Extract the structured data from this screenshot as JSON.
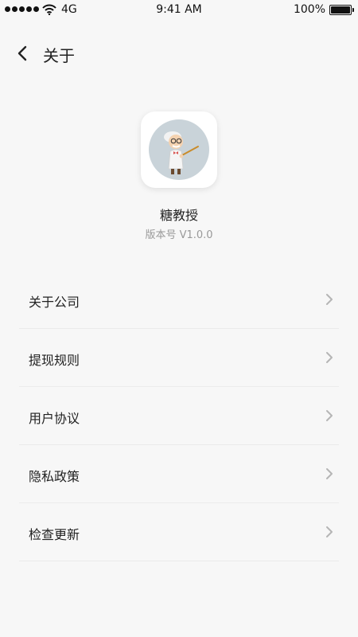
{
  "status_bar": {
    "carrier": "4G",
    "time": "9:41 AM",
    "battery": "100%",
    "battery_level": 1.0
  },
  "nav": {
    "title": "关于",
    "back_icon": "chevron-left-icon"
  },
  "app": {
    "name": "糖教授",
    "version": "版本号 V1.0.0",
    "icon": "professor-mascot-icon"
  },
  "menu": {
    "items": [
      {
        "label": "关于公司"
      },
      {
        "label": "提现规则"
      },
      {
        "label": "用户协议"
      },
      {
        "label": "隐私政策"
      },
      {
        "label": "检查更新"
      }
    ],
    "chevron_icon": "chevron-right-icon"
  },
  "colors": {
    "background": "#f7f7f7",
    "text": "#222222",
    "secondary_text": "#999999",
    "divider": "#ebebeb",
    "chevron": "#b5b5b5"
  }
}
